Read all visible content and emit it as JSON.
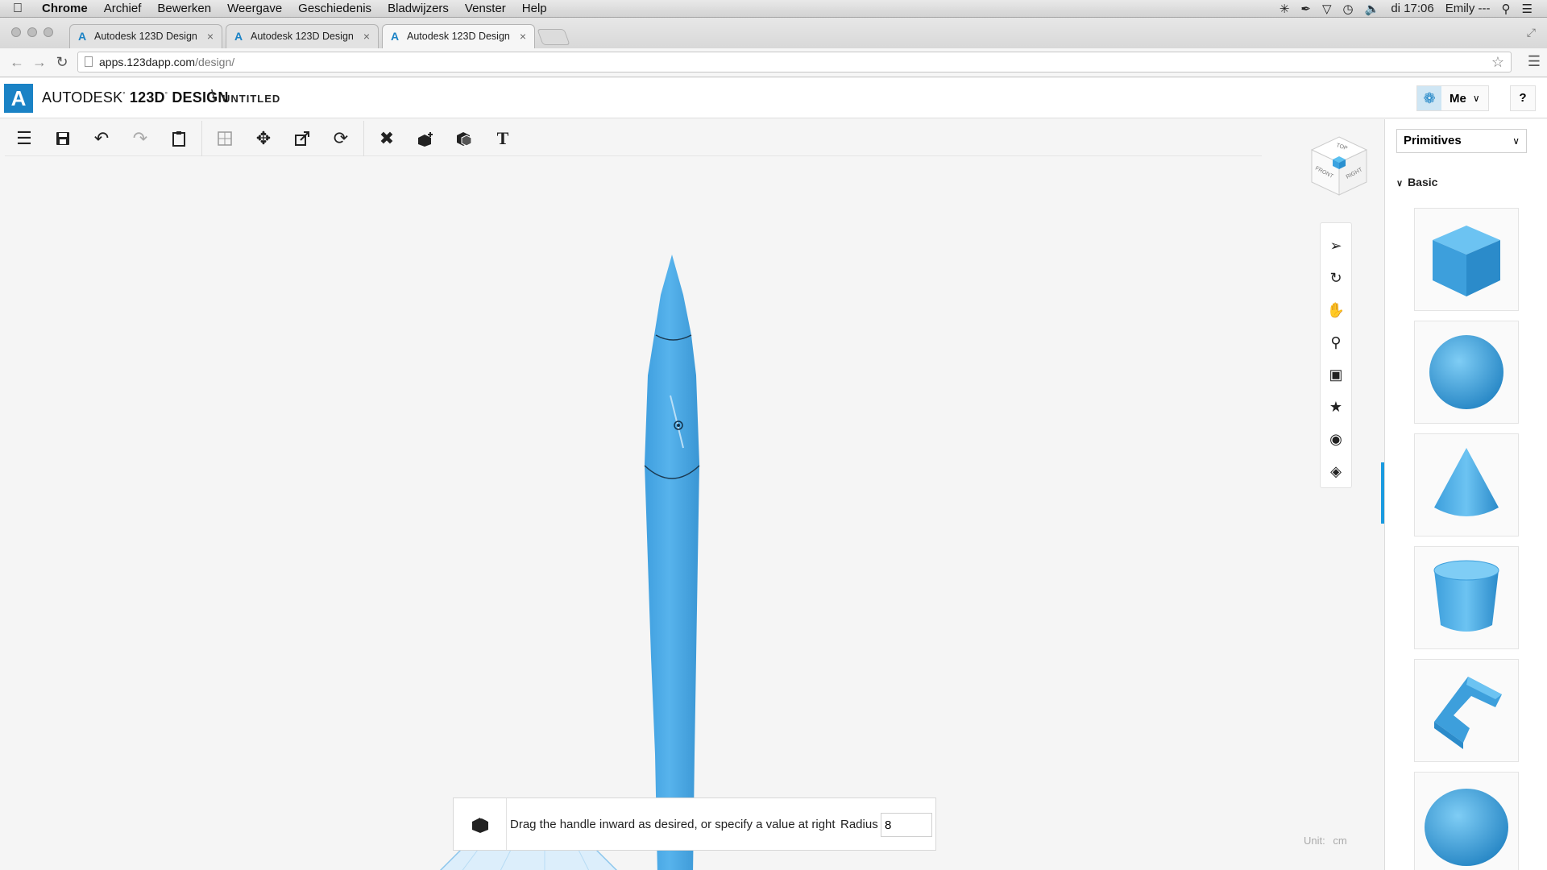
{
  "menubar": {
    "app": "Chrome",
    "items": [
      "Archief",
      "Bewerken",
      "Weergave",
      "Geschiedenis",
      "Bladwijzers",
      "Venster",
      "Help"
    ],
    "clock": "di 17:06",
    "user": "Emily ---"
  },
  "tabs": [
    {
      "title": "Autodesk 123D Design"
    },
    {
      "title": "Autodesk 123D Design"
    },
    {
      "title": "Autodesk 123D Design"
    }
  ],
  "address": {
    "host": "apps.123dapp.com",
    "path": "/design/"
  },
  "app": {
    "brand_prefix": "AUTODESK",
    "brand_product": "123D",
    "brand_suffix": "DESIGN",
    "title_separator": "\\",
    "document_title": "UNTITLED",
    "user_label": "Me",
    "help_label": "?"
  },
  "toolbar_icons": [
    "menu-icon",
    "save-icon",
    "undo-icon",
    "redo-icon",
    "clipboard-icon",
    "smart-move-icon",
    "move-icon",
    "scale-icon",
    "rotate-icon",
    "modify-icon",
    "construct-icon",
    "combine-icon",
    "text-icon"
  ],
  "viewcube": {
    "top": "TOP",
    "front": "FRONT",
    "right": "RIGHT"
  },
  "navigation_icons": [
    "select-icon",
    "orbit-icon",
    "pan-icon",
    "zoom-icon",
    "fit-icon",
    "zoom-selected-icon",
    "visibility-icon",
    "material-icon"
  ],
  "hint": {
    "text": "Drag the handle inward as desired, or specify a value at right",
    "radius_label": "Radius",
    "radius_value": "8"
  },
  "unit": {
    "label": "Unit:",
    "value": "cm"
  },
  "panel": {
    "dropdown": "Primitives",
    "section": "Basic",
    "items": [
      "box-icon",
      "sphere-icon",
      "cone-icon",
      "cylinder-icon",
      "polygon-icon",
      "hemisphere-icon"
    ]
  },
  "colors": {
    "accent": "#1a82c5",
    "model": "#45a9e6"
  }
}
